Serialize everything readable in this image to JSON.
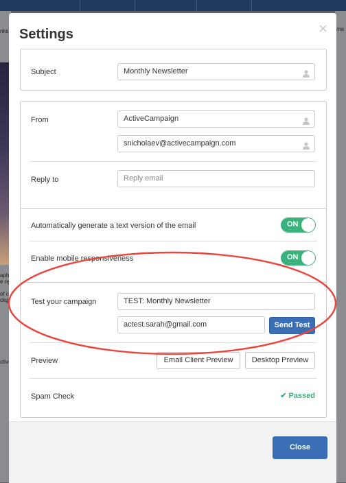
{
  "background": {
    "left_text_lines": [
      "aph",
      "e op",
      "",
      "of c",
      "ckg",
      "",
      "",
      "ctive"
    ],
    "right_text_lines": [
      "ma"
    ],
    "left_tab_text": "nks"
  },
  "modal": {
    "title": "Settings",
    "subject": {
      "label": "Subject",
      "value": "Monthly Newsletter"
    },
    "from": {
      "label": "From",
      "name_value": "ActiveCampaign",
      "email_value": "snicholaev@activecampaign.com"
    },
    "reply_to": {
      "label": "Reply to",
      "placeholder": "Reply email"
    },
    "options": {
      "text_version": {
        "label": "Automatically generate a text version of the email",
        "toggle": "ON"
      },
      "mobile": {
        "label": "Enable mobile responsiveness",
        "toggle": "ON"
      }
    },
    "test": {
      "label": "Test your campaign",
      "subject_value": "TEST: Monthly Newsletter",
      "email_value": "actest.sarah@gmail.com",
      "send_button": "Send Test"
    },
    "preview": {
      "label": "Preview",
      "email_client_button": "Email Client Preview",
      "desktop_button": "Desktop Preview"
    },
    "spam": {
      "label": "Spam Check",
      "status": "Passed"
    },
    "footer": {
      "close_button": "Close"
    }
  },
  "colors": {
    "accent_blue": "#3a6fb5",
    "toggle_green": "#3ab27b",
    "annotation_red": "#e8473f"
  },
  "icons": [
    "person-icon",
    "close-icon",
    "check-icon"
  ]
}
